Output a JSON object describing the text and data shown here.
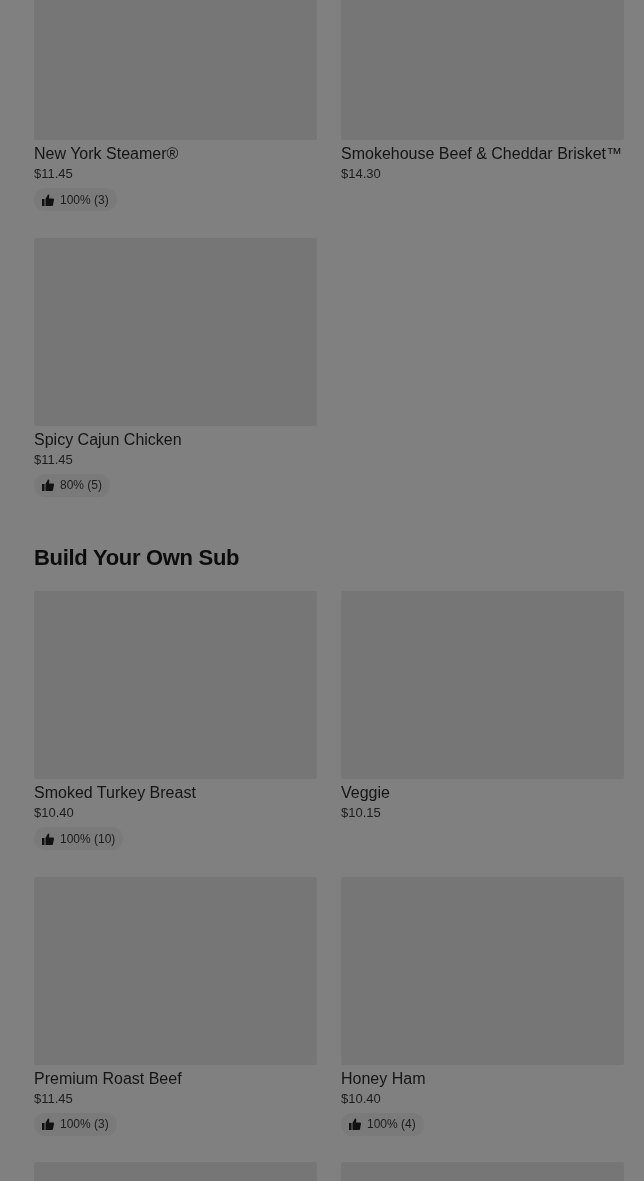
{
  "sections": [
    {
      "items": [
        {
          "kind": "full",
          "name": "New York Steamer®",
          "price": "$11.45",
          "rating": "100% (3)"
        },
        {
          "kind": "full",
          "name": "Smokehouse Beef & Cheddar Brisket™",
          "price": "$14.30"
        },
        {
          "kind": "full",
          "name": "Spicy Cajun Chicken",
          "price": "$11.45",
          "rating": "80% (5)"
        }
      ]
    },
    {
      "title": "Build Your Own Sub",
      "items": [
        {
          "kind": "full",
          "name": "Smoked Turkey Breast",
          "price": "$10.40",
          "rating": "100% (10)"
        },
        {
          "kind": "full",
          "name": "Veggie",
          "price": "$10.15"
        },
        {
          "kind": "full",
          "name": "Premium Roast Beef",
          "price": "$11.45",
          "rating": "100% (3)"
        },
        {
          "kind": "full",
          "name": "Honey Ham",
          "price": "$10.40",
          "rating": "100% (4)"
        },
        {
          "kind": "image-only"
        },
        {
          "kind": "image-only"
        }
      ]
    }
  ]
}
